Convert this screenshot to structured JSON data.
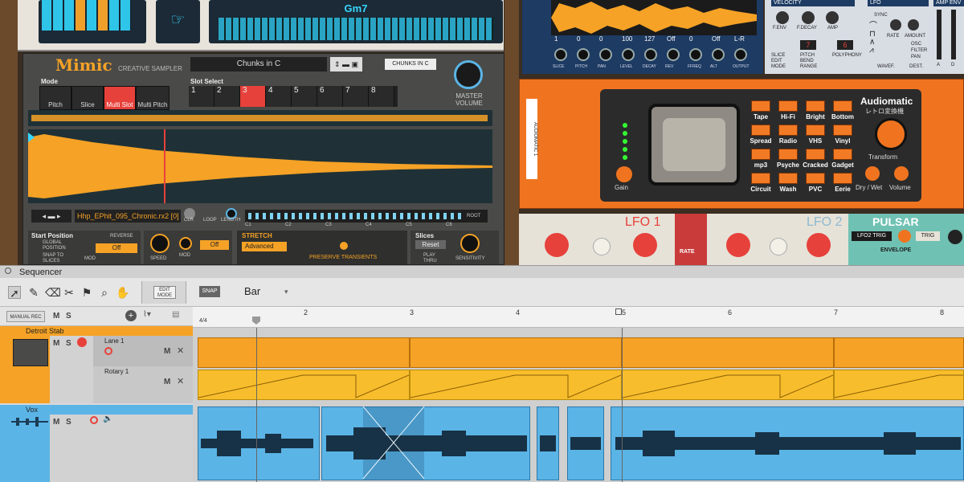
{
  "keyboard": {
    "chord": "Gm7"
  },
  "mimic": {
    "logo": "Mimic",
    "subtitle": "CREATIVE SAMPLER",
    "patch": "Chunks in C",
    "patch_label": "CHUNKS IN C",
    "mode_label": "Mode",
    "modes": [
      "Pitch",
      "Slice",
      "Multi Slot",
      "Multi Pitch"
    ],
    "slot_select_label": "Slot Select",
    "slots": [
      "1",
      "2",
      "3",
      "4",
      "5",
      "6",
      "7",
      "8"
    ],
    "master_volume": "MASTER VOLUME",
    "sample_name": "Hhp_EPhit_095_Chronic.rx2 [0]",
    "clr": "CLR",
    "loop": "LOOP",
    "length": "LENGTH",
    "start_position": "Start Position",
    "global_position": "GLOBAL POSITION",
    "snap_to_slices": "SNAP TO SLICES",
    "reverse": "REVERSE",
    "off": "Off",
    "speed": "SPEED",
    "mod": "MOD",
    "stretch": "STRETCH",
    "advanced": "Advanced",
    "preserve_transients": "PRESERVE TRANSIENTS",
    "slices": "Slices",
    "reset": "Reset",
    "play_thru": "PLAY THRU",
    "sensitivity": "SENSITIVITY",
    "root": "ROOT",
    "notes": [
      "C1",
      "C2",
      "C3",
      "C4",
      "C5",
      "C6"
    ]
  },
  "drum": {
    "values": [
      "1",
      "0",
      "0",
      "100",
      "127",
      "Off",
      "0",
      "Off",
      "L-R"
    ],
    "labels": [
      "SLICE",
      "PITCH",
      "PAN",
      "LEVEL",
      "DECAY",
      "REV",
      "FFREQ",
      "ALT",
      "OUTPUT"
    ]
  },
  "velocity": {
    "title": "VELOCITY",
    "knobs": [
      "F.ENV",
      "F.DECAY",
      "AMP"
    ],
    "slice_edit_mode": "SLICE EDIT MODE",
    "pitch_bend_range": "PITCH BEND RANGE",
    "polyphony": "POLYPHONY",
    "bend_value": "7",
    "poly_value": "6",
    "lfo": "LFO",
    "sync": "SYNC",
    "rate": "RATE",
    "amount": "AMOUNT",
    "osc": "OSC",
    "filter": "FILTER",
    "pan": "PAN",
    "wavef": "WAVEF.",
    "dest": "DEST.",
    "amp_env": "AMP ENV",
    "a": "A",
    "d": "D"
  },
  "audiomatic": {
    "title": "Audiomatic",
    "subtitle": "レトロ変換機",
    "side_label": "AUDIOMATIC 1",
    "presets": [
      "Tape",
      "Hi-Fi",
      "Bright",
      "Bottom",
      "Spread",
      "Radio",
      "VHS",
      "Vinyl",
      "mp3",
      "Psyche",
      "Cracked",
      "Gadget",
      "Circuit",
      "Wash",
      "PVC",
      "Eerie"
    ],
    "gain": "Gain",
    "transform": "Transform",
    "dry_wet": "Dry / Wet",
    "volume": "Volume"
  },
  "pulsar": {
    "lfo1": "LFO",
    "lfo1_num": "1",
    "lfo2": "LFO",
    "lfo2_num": "2",
    "rate": "RATE",
    "title": "PULSAR",
    "lfo2_trig": "LFO2 TRIG",
    "trig": "TRIG",
    "envelope": "ENVELOPE"
  },
  "sequencer": {
    "title": "Sequencer",
    "edit_mode": "EDIT MODE",
    "snap": "SNAP",
    "snap_value": "Bar",
    "manual_rec": "MANUAL REC",
    "m": "M",
    "s": "S",
    "time_sig": "4/4",
    "bars": [
      "2",
      "3",
      "4",
      "5",
      "6",
      "7",
      "8"
    ],
    "tracks": {
      "detroit": "Detroit Stab",
      "lane1": "Lane 1",
      "rotary": "Rotary 1",
      "vox": "Vox"
    }
  },
  "colors": {
    "accent_orange": "#f5a226",
    "accent_yellow": "#f8bd2c",
    "accent_blue": "#5bb4e6",
    "record_red": "#e7413b"
  }
}
